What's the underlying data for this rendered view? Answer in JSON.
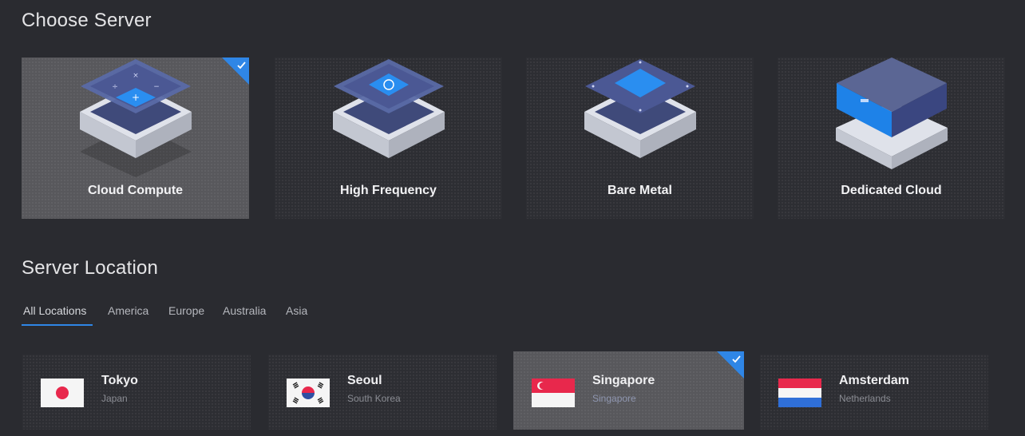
{
  "page": {
    "server_title": "Choose Server",
    "location_title": "Server Location"
  },
  "servers": [
    {
      "label": "Cloud Compute",
      "selected": true
    },
    {
      "label": "High Frequency",
      "selected": false
    },
    {
      "label": "Bare Metal",
      "selected": false
    },
    {
      "label": "Dedicated Cloud",
      "selected": false
    }
  ],
  "tabs": [
    {
      "label": "All Locations",
      "active": true
    },
    {
      "label": "America",
      "active": false
    },
    {
      "label": "Europe",
      "active": false
    },
    {
      "label": "Australia",
      "active": false
    },
    {
      "label": "Asia",
      "active": false
    }
  ],
  "locations": [
    {
      "city": "Tokyo",
      "country": "Japan",
      "flag": "japan-flag-icon",
      "selected": false
    },
    {
      "city": "Seoul",
      "country": "South Korea",
      "flag": "south-korea-flag-icon",
      "selected": false
    },
    {
      "city": "Singapore",
      "country": "Singapore",
      "flag": "singapore-flag-icon",
      "selected": true
    },
    {
      "city": "Amsterdam",
      "country": "Netherlands",
      "flag": "netherlands-flag-icon",
      "selected": false
    }
  ],
  "colors": {
    "accent": "#2f86e6",
    "background": "#2a2b30",
    "selected_card": "#58585c"
  }
}
